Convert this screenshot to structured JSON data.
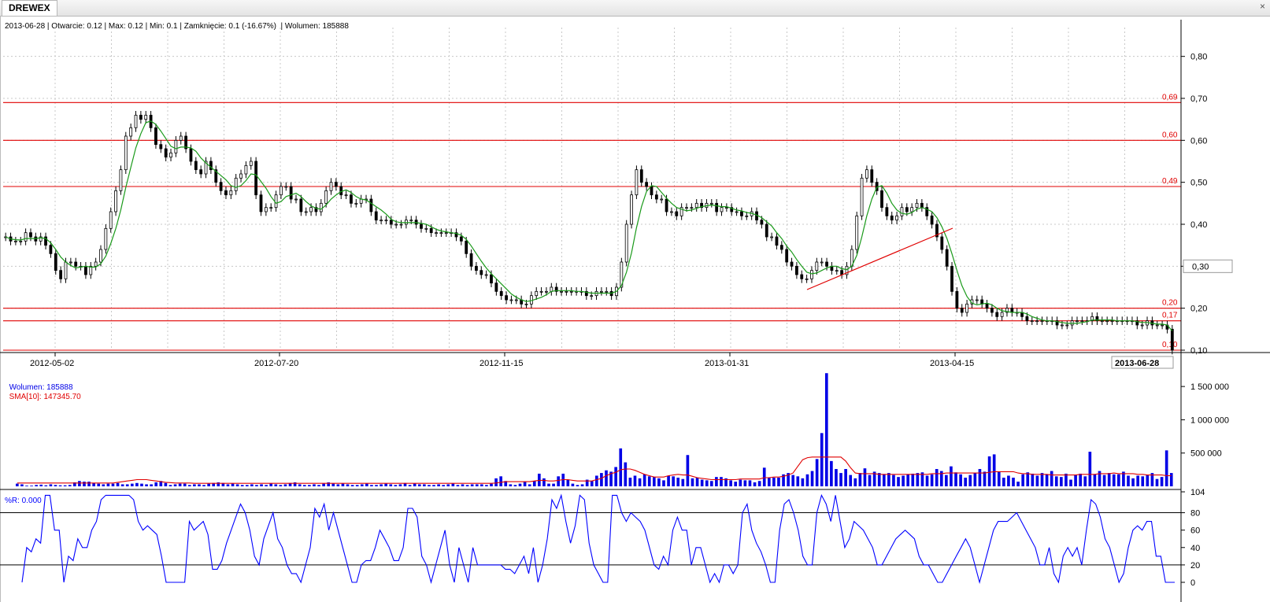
{
  "window": {
    "tab_label": "DREWEX",
    "close_glyph": "×"
  },
  "price_panel": {
    "info": "2013-06-28 | Otwarcie: 0.12 | Max: 0.12 | Min: 0.1 | Zamknięcie: 0.1 (-16.67%)  | Wolumen: 185888",
    "y_ticks": [
      "0,80",
      "0,70",
      "0,60",
      "0,50",
      "0,40",
      "0,30",
      "0,20",
      "0,10"
    ],
    "y_tick_values": [
      0.8,
      0.7,
      0.6,
      0.5,
      0.4,
      0.3,
      0.2,
      0.1
    ],
    "current_value_label": "0,30",
    "x_ticks": [
      "2012-05-02",
      "2012-07-20",
      "2012-11-15",
      "2013-01-31",
      "2013-04-15"
    ],
    "last_date_label": "2013-06-28",
    "levels": [
      {
        "value": 0.69,
        "label": "0,69"
      },
      {
        "value": 0.6,
        "label": "0,60"
      },
      {
        "value": 0.49,
        "label": "0,49"
      },
      {
        "value": 0.2,
        "label": "0,20"
      },
      {
        "value": 0.17,
        "label": "0,17"
      },
      {
        "value": 0.1,
        "label": "0,10"
      }
    ]
  },
  "volume_panel": {
    "label_volume": "Wolumen: 185888",
    "label_sma": "SMA[10]: 147345.70",
    "y_ticks": [
      "1 500 000",
      "1 000 000",
      "500 000"
    ],
    "y_tick_values": [
      1500000,
      1000000,
      500000
    ]
  },
  "wr_panel": {
    "label": "%R: 0.000",
    "y_ticks": [
      "104",
      "80",
      "60",
      "40",
      "20",
      "0"
    ],
    "y_tick_values": [
      104,
      80,
      60,
      40,
      20,
      0
    ]
  },
  "colors": {
    "up_candle": "#ffffff",
    "down_candle": "#000000",
    "sma_price": "#1a9a1a",
    "level_line": "#e00000",
    "volume_bar": "#0000e6",
    "volume_sma": "#e00000",
    "wr_line": "#0000ff",
    "grid": "#c8c8c8"
  },
  "chart_data": {
    "type": "candlestick",
    "instrument": "DREWEX",
    "closes": [
      0.37,
      0.36,
      0.36,
      0.36,
      0.38,
      0.37,
      0.36,
      0.37,
      0.35,
      0.33,
      0.29,
      0.27,
      0.31,
      0.31,
      0.3,
      0.3,
      0.28,
      0.3,
      0.31,
      0.34,
      0.39,
      0.43,
      0.48,
      0.53,
      0.61,
      0.63,
      0.66,
      0.65,
      0.66,
      0.63,
      0.59,
      0.58,
      0.56,
      0.57,
      0.6,
      0.61,
      0.58,
      0.55,
      0.53,
      0.52,
      0.55,
      0.53,
      0.5,
      0.48,
      0.47,
      0.48,
      0.51,
      0.52,
      0.54,
      0.55,
      0.47,
      0.43,
      0.44,
      0.44,
      0.47,
      0.49,
      0.49,
      0.46,
      0.46,
      0.43,
      0.43,
      0.44,
      0.43,
      0.45,
      0.48,
      0.5,
      0.49,
      0.47,
      0.47,
      0.45,
      0.45,
      0.46,
      0.46,
      0.43,
      0.41,
      0.41,
      0.41,
      0.4,
      0.4,
      0.4,
      0.41,
      0.41,
      0.4,
      0.39,
      0.39,
      0.38,
      0.38,
      0.38,
      0.38,
      0.38,
      0.37,
      0.36,
      0.33,
      0.3,
      0.29,
      0.28,
      0.28,
      0.26,
      0.24,
      0.23,
      0.22,
      0.22,
      0.22,
      0.21,
      0.21,
      0.23,
      0.24,
      0.24,
      0.24,
      0.25,
      0.24,
      0.24,
      0.24,
      0.24,
      0.24,
      0.24,
      0.23,
      0.23,
      0.24,
      0.24,
      0.24,
      0.23,
      0.25,
      0.31,
      0.4,
      0.47,
      0.53,
      0.5,
      0.49,
      0.47,
      0.46,
      0.46,
      0.43,
      0.43,
      0.42,
      0.44,
      0.44,
      0.44,
      0.45,
      0.44,
      0.45,
      0.45,
      0.43,
      0.44,
      0.44,
      0.43,
      0.43,
      0.42,
      0.42,
      0.43,
      0.41,
      0.4,
      0.37,
      0.37,
      0.35,
      0.34,
      0.31,
      0.3,
      0.28,
      0.27,
      0.27,
      0.29,
      0.31,
      0.31,
      0.3,
      0.29,
      0.29,
      0.28,
      0.3,
      0.34,
      0.42,
      0.51,
      0.53,
      0.5,
      0.48,
      0.44,
      0.42,
      0.41,
      0.42,
      0.44,
      0.43,
      0.44,
      0.45,
      0.44,
      0.42,
      0.4,
      0.37,
      0.34,
      0.3,
      0.24,
      0.2,
      0.19,
      0.21,
      0.22,
      0.22,
      0.21,
      0.2,
      0.19,
      0.18,
      0.19,
      0.2,
      0.19,
      0.19,
      0.18,
      0.17,
      0.17,
      0.17,
      0.17,
      0.17,
      0.17,
      0.16,
      0.16,
      0.16,
      0.17,
      0.17,
      0.17,
      0.17,
      0.18,
      0.17,
      0.17,
      0.17,
      0.17,
      0.17,
      0.17,
      0.17,
      0.17,
      0.16,
      0.16,
      0.17,
      0.16,
      0.16,
      0.16,
      0.15,
      0.1
    ],
    "volume_values_k": [
      40,
      30,
      10,
      10,
      20,
      25,
      15,
      30,
      20,
      15,
      15,
      20,
      60,
      80,
      70,
      70,
      50,
      40,
      30,
      40,
      40,
      50,
      30,
      30,
      40,
      50,
      40,
      30,
      30,
      60,
      80,
      50,
      20,
      30,
      40,
      40,
      20,
      30,
      30,
      20,
      40,
      50,
      60,
      50,
      30,
      40,
      30,
      20,
      20,
      30,
      20,
      30,
      20,
      40,
      30,
      20,
      30,
      50,
      60,
      30,
      20,
      20,
      30,
      20,
      40,
      60,
      40,
      30,
      40,
      30,
      20,
      20,
      30,
      40,
      20,
      20,
      30,
      40,
      30,
      20,
      30,
      50,
      20,
      40,
      30,
      30,
      20,
      20,
      30,
      20,
      30,
      40,
      20,
      30,
      20,
      30,
      30,
      30,
      20,
      40,
      120,
      150,
      80,
      30,
      20,
      40,
      70,
      30,
      80,
      190,
      120,
      40,
      40,
      150,
      190,
      100,
      40,
      20,
      30,
      100,
      80,
      160,
      200,
      240,
      220,
      290,
      570,
      360,
      130,
      160,
      120,
      180,
      150,
      140,
      120,
      90,
      160,
      150,
      130,
      110,
      470,
      120,
      130,
      100,
      90,
      80,
      140,
      140,
      120,
      90,
      70,
      100,
      90,
      90,
      60,
      80,
      280,
      130,
      130,
      130,
      180,
      200,
      170,
      150,
      120,
      180,
      230,
      410,
      800,
      1700,
      380,
      260,
      200,
      260,
      170,
      120,
      200,
      270,
      170,
      220,
      200,
      180,
      200,
      170,
      140,
      160,
      180,
      190,
      200,
      210,
      160,
      180,
      260,
      230,
      170,
      300,
      210,
      180,
      130,
      170,
      200,
      260,
      220,
      450,
      480,
      220,
      130,
      160,
      130,
      70,
      180,
      210,
      190,
      160,
      200,
      180,
      230,
      150,
      140,
      190,
      100,
      170,
      190,
      150,
      520,
      180,
      230,
      170,
      200,
      180,
      180,
      220,
      160,
      120,
      160,
      150,
      170,
      200,
      110,
      140,
      540,
      200
    ],
    "volume_sma_k": [
      50,
      50,
      50,
      50,
      50,
      50,
      50,
      50,
      50,
      50,
      50,
      50,
      50,
      50,
      50,
      50,
      50,
      50,
      50,
      50,
      50,
      60,
      70,
      80,
      90,
      100,
      100,
      100,
      90,
      80,
      70,
      60,
      55,
      50,
      50,
      50,
      50,
      45,
      45,
      45,
      45,
      45,
      45,
      45,
      45,
      45,
      45,
      45,
      45,
      45,
      45,
      45,
      45,
      45,
      45,
      45,
      45,
      45,
      45,
      45,
      45,
      45,
      45,
      45,
      45,
      45,
      45,
      45,
      45,
      45,
      45,
      45,
      45,
      45,
      45,
      45,
      45,
      45,
      45,
      45,
      45,
      45,
      45,
      45,
      45,
      45,
      45,
      45,
      45,
      45,
      45,
      45,
      45,
      45,
      45,
      45,
      45,
      45,
      45,
      45,
      50,
      60,
      70,
      70,
      70,
      70,
      70,
      70,
      80,
      90,
      90,
      80,
      80,
      90,
      100,
      100,
      90,
      80,
      80,
      80,
      80,
      100,
      120,
      160,
      190,
      210,
      250,
      260,
      260,
      240,
      210,
      180,
      160,
      140,
      140,
      140,
      160,
      170,
      180,
      170,
      170,
      150,
      130,
      120,
      110,
      100,
      100,
      100,
      100,
      100,
      100,
      110,
      110,
      110,
      110,
      110,
      130,
      130,
      140,
      140,
      150,
      170,
      200,
      300,
      400,
      430,
      440,
      440,
      440,
      440,
      440,
      440,
      440,
      380,
      280,
      200,
      190,
      190,
      190,
      190,
      180,
      180,
      180,
      180,
      180,
      180,
      180,
      180,
      180,
      180,
      180,
      190,
      190,
      190,
      200,
      200,
      200,
      200,
      200,
      200,
      200,
      200,
      200,
      210,
      220,
      220,
      220,
      220,
      220,
      200,
      190,
      190,
      180,
      180,
      180,
      180,
      170,
      170,
      170,
      170,
      170,
      170,
      180,
      180,
      180,
      180,
      190,
      190,
      190,
      200,
      190,
      190,
      190,
      190,
      180,
      180,
      170,
      170,
      170,
      170,
      160,
      160,
      150,
      150,
      140,
      140,
      150,
      150
    ],
    "williams_r": [
      0,
      40,
      35,
      50,
      45,
      100,
      100,
      60,
      60,
      0,
      30,
      25,
      50,
      40,
      40,
      60,
      70,
      95,
      100,
      100,
      100,
      100,
      100,
      100,
      95,
      70,
      60,
      65,
      60,
      55,
      30,
      0,
      0,
      0,
      0,
      0,
      70,
      60,
      65,
      70,
      55,
      15,
      15,
      25,
      45,
      60,
      75,
      90,
      80,
      60,
      30,
      20,
      50,
      65,
      80,
      50,
      40,
      20,
      10,
      10,
      0,
      20,
      40,
      85,
      75,
      90,
      60,
      80,
      60,
      40,
      20,
      0,
      0,
      20,
      25,
      25,
      40,
      60,
      50,
      40,
      25,
      25,
      40,
      85,
      85,
      75,
      30,
      20,
      0,
      20,
      40,
      60,
      20,
      0,
      40,
      20,
      0,
      40,
      20,
      20,
      20,
      20,
      20,
      20,
      15,
      15,
      10,
      20,
      30,
      10,
      40,
      0,
      20,
      50,
      95,
      85,
      100,
      70,
      45,
      65,
      100,
      95,
      45,
      20,
      10,
      0,
      0,
      100,
      100,
      80,
      70,
      80,
      75,
      70,
      60,
      40,
      20,
      15,
      30,
      20,
      60,
      75,
      60,
      60,
      20,
      40,
      40,
      20,
      0,
      10,
      0,
      20,
      20,
      10,
      20,
      80,
      90,
      60,
      45,
      35,
      20,
      0,
      0,
      60,
      90,
      95,
      80,
      60,
      30,
      20,
      20,
      80,
      100,
      90,
      70,
      100,
      70,
      40,
      50,
      70,
      65,
      60,
      50,
      40,
      20,
      20,
      30,
      40,
      50,
      55,
      60,
      55,
      50,
      30,
      20,
      20,
      10,
      0,
      0,
      10,
      20,
      30,
      40,
      50,
      40,
      20,
      0,
      20,
      40,
      60,
      70,
      70,
      70,
      75,
      80,
      70,
      60,
      50,
      40,
      20,
      20,
      40,
      10,
      0,
      30,
      40,
      30,
      40,
      20,
      60,
      95,
      90,
      75,
      50,
      40,
      20,
      0,
      10,
      40,
      60,
      65,
      60,
      70,
      70,
      30,
      30,
      0,
      0,
      0
    ]
  }
}
